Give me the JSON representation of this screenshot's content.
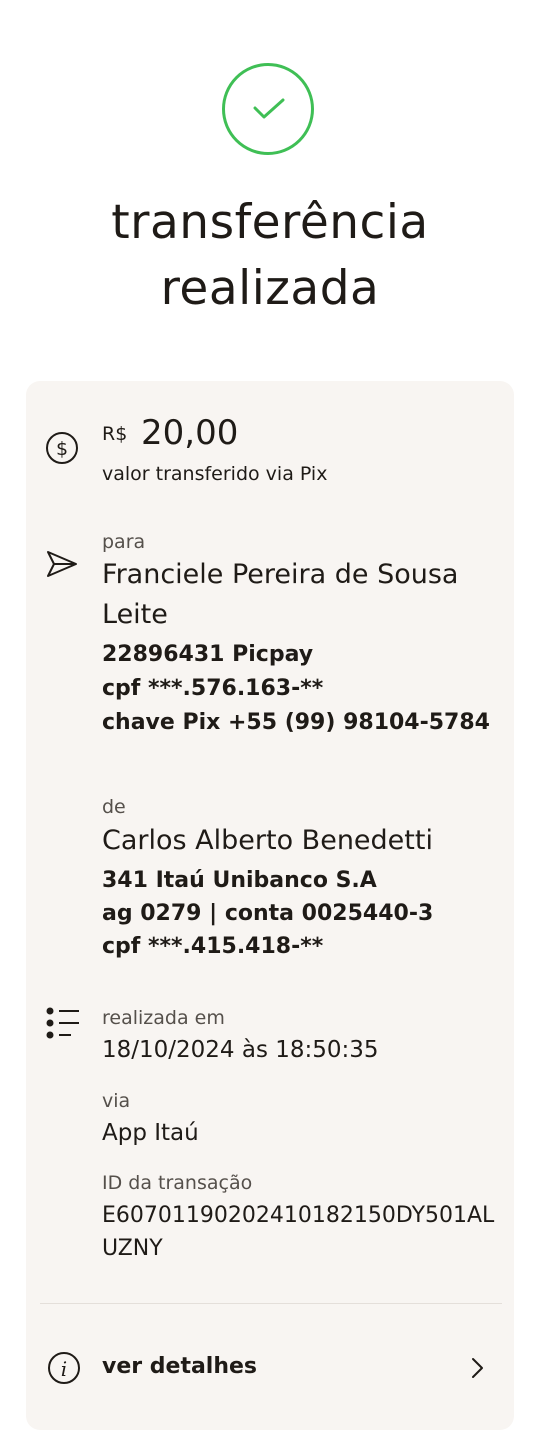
{
  "header": {
    "title_line1": "transferência",
    "title_line2": "realizada",
    "success_color": "#3fbf55"
  },
  "amount": {
    "currency": "R$",
    "value": "20,00",
    "caption": "valor transferido via Pix",
    "icon": "dollar-circle-icon"
  },
  "recipient": {
    "label": "para",
    "name_line1": "Franciele Pereira de Sousa",
    "name_line2": "Leite",
    "institution": "22896431 Picpay",
    "cpf": "cpf ***.576.163-**",
    "pix_key": "chave Pix +55 (99) 98104-5784",
    "icon": "send-icon"
  },
  "sender": {
    "label": "de",
    "name": "Carlos Alberto Benedetti",
    "bank": "341 Itaú Unibanco S.A",
    "account": "ag 0279 | conta 0025440-3",
    "cpf": "cpf ***.415.418-**"
  },
  "transaction": {
    "icon": "list-icon",
    "date_label": "realizada em",
    "date_value": "18/10/2024 às 18:50:35",
    "via_label": "via",
    "via_value": "App Itaú",
    "id_label": "ID da transação",
    "id_line1": "E60701190202410182150DY501AL",
    "id_line2": "UZNY"
  },
  "details": {
    "label": "ver detalhes",
    "icon": "info-icon",
    "chevron": "chevron-right-icon"
  }
}
